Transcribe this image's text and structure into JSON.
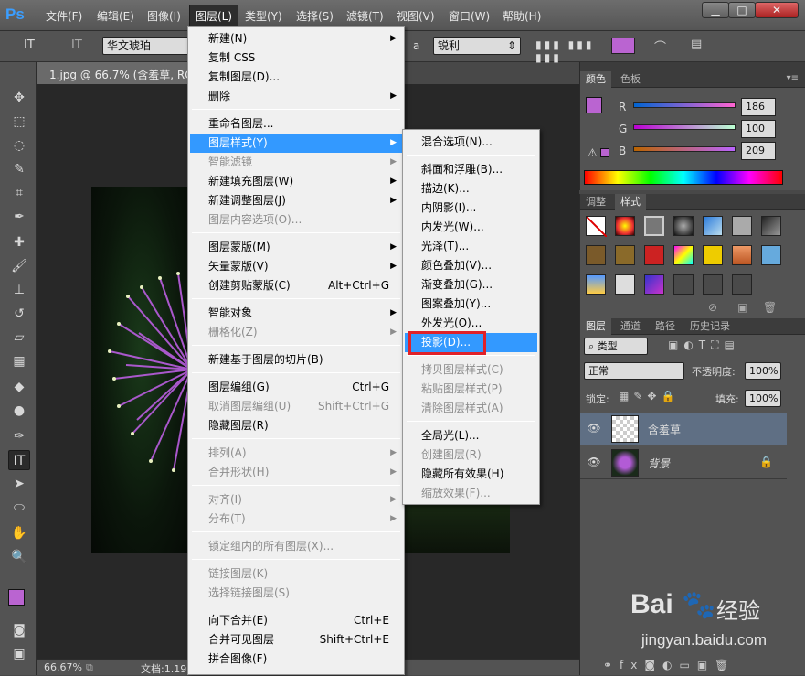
{
  "app": {
    "logo": "Ps"
  },
  "menubar": [
    "文件(F)",
    "编辑(E)",
    "图像(I)",
    "图层(L)",
    "类型(Y)",
    "选择(S)",
    "滤镜(T)",
    "视图(V)",
    "窗口(W)",
    "帮助(H)"
  ],
  "window_controls": {
    "minimize": "▁",
    "restore": "□",
    "close": "✕"
  },
  "options": {
    "tool_icon": "IT",
    "font_name": "华文琥珀",
    "aa_label": "a",
    "aa_value": "锐利",
    "orientation_icon": "IT"
  },
  "document": {
    "tab_title": "1.jpg @ 66.7% (含羞草, RGB",
    "zoom": "66.67%",
    "doc_info": "文档:1.19"
  },
  "layer_menu": {
    "items": [
      {
        "label": "新建(N)",
        "shortcut": "",
        "arrow": true,
        "disabled": false
      },
      {
        "label": "复制 CSS",
        "shortcut": "",
        "arrow": false,
        "disabled": false
      },
      {
        "label": "复制图层(D)...",
        "shortcut": "",
        "arrow": false,
        "disabled": false
      },
      {
        "label": "删除",
        "shortcut": "",
        "arrow": true,
        "disabled": false
      },
      {
        "label": "重命名图层...",
        "shortcut": "",
        "arrow": false,
        "disabled": false
      },
      {
        "label": "图层样式(Y)",
        "shortcut": "",
        "arrow": true,
        "disabled": false,
        "highlight": true
      },
      {
        "label": "智能滤镜",
        "shortcut": "",
        "arrow": true,
        "disabled": true
      },
      {
        "label": "新建填充图层(W)",
        "shortcut": "",
        "arrow": true,
        "disabled": false
      },
      {
        "label": "新建调整图层(J)",
        "shortcut": "",
        "arrow": true,
        "disabled": false
      },
      {
        "label": "图层内容选项(O)...",
        "shortcut": "",
        "arrow": false,
        "disabled": true
      },
      {
        "label": "图层蒙版(M)",
        "shortcut": "",
        "arrow": true,
        "disabled": false
      },
      {
        "label": "矢量蒙版(V)",
        "shortcut": "",
        "arrow": true,
        "disabled": false
      },
      {
        "label": "创建剪贴蒙版(C)",
        "shortcut": "Alt+Ctrl+G",
        "arrow": false,
        "disabled": false
      },
      {
        "label": "智能对象",
        "shortcut": "",
        "arrow": true,
        "disabled": false
      },
      {
        "label": "栅格化(Z)",
        "shortcut": "",
        "arrow": true,
        "disabled": true
      },
      {
        "label": "新建基于图层的切片(B)",
        "shortcut": "",
        "arrow": false,
        "disabled": false
      },
      {
        "label": "图层编组(G)",
        "shortcut": "Ctrl+G",
        "arrow": false,
        "disabled": false
      },
      {
        "label": "取消图层编组(U)",
        "shortcut": "Shift+Ctrl+G",
        "arrow": false,
        "disabled": true
      },
      {
        "label": "隐藏图层(R)",
        "shortcut": "",
        "arrow": false,
        "disabled": false
      },
      {
        "label": "排列(A)",
        "shortcut": "",
        "arrow": true,
        "disabled": true
      },
      {
        "label": "合并形状(H)",
        "shortcut": "",
        "arrow": true,
        "disabled": true
      },
      {
        "label": "对齐(I)",
        "shortcut": "",
        "arrow": true,
        "disabled": true
      },
      {
        "label": "分布(T)",
        "shortcut": "",
        "arrow": true,
        "disabled": true
      },
      {
        "label": "锁定组内的所有图层(X)...",
        "shortcut": "",
        "arrow": false,
        "disabled": true
      },
      {
        "label": "链接图层(K)",
        "shortcut": "",
        "arrow": false,
        "disabled": true
      },
      {
        "label": "选择链接图层(S)",
        "shortcut": "",
        "arrow": false,
        "disabled": true
      },
      {
        "label": "向下合并(E)",
        "shortcut": "Ctrl+E",
        "arrow": false,
        "disabled": false
      },
      {
        "label": "合并可见图层",
        "shortcut": "Shift+Ctrl+E",
        "arrow": false,
        "disabled": false
      },
      {
        "label": "拼合图像(F)",
        "shortcut": "",
        "arrow": false,
        "disabled": false
      }
    ]
  },
  "style_menu": {
    "items": [
      {
        "label": "混合选项(N)...",
        "disabled": false
      },
      {
        "label": "斜面和浮雕(B)...",
        "disabled": false
      },
      {
        "label": "描边(K)...",
        "disabled": false
      },
      {
        "label": "内阴影(I)...",
        "disabled": false
      },
      {
        "label": "内发光(W)...",
        "disabled": false
      },
      {
        "label": "光泽(T)...",
        "disabled": false
      },
      {
        "label": "颜色叠加(V)...",
        "disabled": false
      },
      {
        "label": "渐变叠加(G)...",
        "disabled": false
      },
      {
        "label": "图案叠加(Y)...",
        "disabled": false
      },
      {
        "label": "外发光(O)...",
        "disabled": false
      },
      {
        "label": "投影(D)...",
        "disabled": false,
        "highlight": true
      },
      {
        "label": "拷贝图层样式(C)",
        "disabled": true
      },
      {
        "label": "粘贴图层样式(P)",
        "disabled": true
      },
      {
        "label": "清除图层样式(A)",
        "disabled": true
      },
      {
        "label": "全局光(L)...",
        "disabled": false
      },
      {
        "label": "创建图层(R)",
        "disabled": true
      },
      {
        "label": "隐藏所有效果(H)",
        "disabled": false
      },
      {
        "label": "缩放效果(F)...",
        "disabled": true
      }
    ]
  },
  "color_panel": {
    "tabs": [
      "颜色",
      "色板"
    ],
    "channels": [
      {
        "label": "R",
        "value": "186"
      },
      {
        "label": "G",
        "value": "100"
      },
      {
        "label": "B",
        "value": "209"
      }
    ],
    "fg_color": "#ba64d1"
  },
  "styles_panel": {
    "tabs": [
      "调整",
      "样式"
    ]
  },
  "layers_panel": {
    "tabs": [
      "图层",
      "通道",
      "路径",
      "历史记录"
    ],
    "filter": "类型",
    "blend_mode": "正常",
    "opacity_label": "不透明度:",
    "opacity": "100%",
    "lock_label": "锁定:",
    "fill_label": "填充:",
    "fill": "100%",
    "layers": [
      {
        "name": "含羞草",
        "selected": true,
        "locked": false
      },
      {
        "name": "背景",
        "selected": false,
        "locked": true
      }
    ]
  },
  "watermark": {
    "brand": "Bai",
    "brand2": "经验",
    "url": "jingyan.baidu.com"
  }
}
